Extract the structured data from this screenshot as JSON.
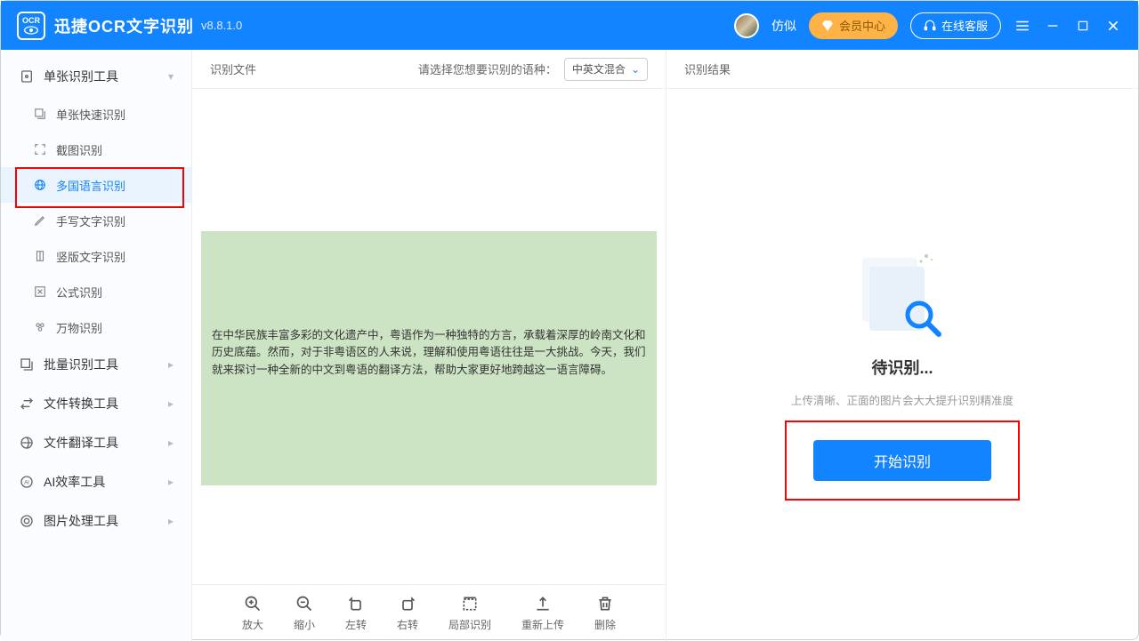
{
  "app": {
    "title": "迅捷OCR文字识别",
    "version": "v8.8.1.0"
  },
  "titlebar": {
    "username": "仿似",
    "vip": "会员中心",
    "service": "在线客服"
  },
  "sidebar": {
    "sections": [
      {
        "label": "单张识别工具"
      },
      {
        "label": "批量识别工具"
      },
      {
        "label": "文件转换工具"
      },
      {
        "label": "文件翻译工具"
      },
      {
        "label": "AI效率工具"
      },
      {
        "label": "图片处理工具"
      }
    ],
    "items": [
      {
        "label": "单张快速识别"
      },
      {
        "label": "截图识别"
      },
      {
        "label": "多国语言识别"
      },
      {
        "label": "手写文字识别"
      },
      {
        "label": "竖版文字识别"
      },
      {
        "label": "公式识别"
      },
      {
        "label": "万物识别"
      }
    ]
  },
  "center": {
    "head": "识别文件",
    "lang_label": "请选择您想要识别的语种：",
    "lang_value": "中英文混合",
    "doc_text": "在中华民族丰富多彩的文化遗产中，粤语作为一种独特的方言，承载着深厚的岭南文化和历史底蕴。然而，对于非粤语区的人来说，理解和使用粤语往往是一大挑战。今天，我们就来探讨一种全新的中文到粤语的翻译方法，帮助大家更好地跨越这一语言障碍。"
  },
  "toolbar": {
    "zoom_in": "放大",
    "zoom_out": "缩小",
    "rotate_left": "左转",
    "rotate_right": "右转",
    "partial": "局部识别",
    "reupload": "重新上传",
    "delete": "删除"
  },
  "right": {
    "head": "识别结果",
    "status": "待识别...",
    "hint": "上传清晰、正面的图片会大大提升识别精准度",
    "button": "开始识别"
  }
}
